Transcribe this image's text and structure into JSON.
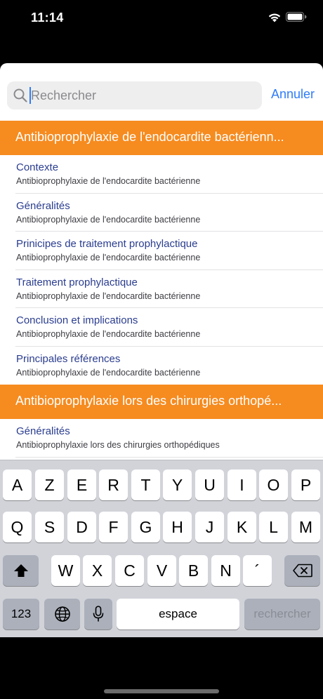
{
  "status_bar": {
    "time": "11:14"
  },
  "search": {
    "placeholder": "Rechercher",
    "value": "",
    "cancel_label": "Annuler"
  },
  "sections": [
    {
      "header": "Antibioprophylaxie de l'endocardite bactérienn...",
      "rows": [
        {
          "title": "Contexte",
          "subtitle": "Antibioprophylaxie de l'endocardite bactérienne"
        },
        {
          "title": "Généralités",
          "subtitle": "Antibioprophylaxie de l'endocardite bactérienne"
        },
        {
          "title": "Prinicipes de traitement prophylactique",
          "subtitle": "Antibioprophylaxie de l'endocardite bactérienne"
        },
        {
          "title": "Traitement prophylactique",
          "subtitle": "Antibioprophylaxie de l'endocardite bactérienne"
        },
        {
          "title": "Conclusion et implications",
          "subtitle": "Antibioprophylaxie de l'endocardite bactérienne"
        },
        {
          "title": "Principales références",
          "subtitle": "Antibioprophylaxie de l'endocardite bactérienne"
        }
      ]
    },
    {
      "header": "Antibioprophylaxie lors des chirurgies orthopé...",
      "rows": [
        {
          "title": "Généralités",
          "subtitle": "Antibioprophylaxie lors des chirurgies orthopédiques"
        }
      ]
    }
  ],
  "keyboard": {
    "row1": [
      "A",
      "Z",
      "E",
      "R",
      "T",
      "Y",
      "U",
      "I",
      "O",
      "P"
    ],
    "row2": [
      "Q",
      "S",
      "D",
      "F",
      "G",
      "H",
      "J",
      "K",
      "L",
      "M"
    ],
    "row3": [
      "W",
      "X",
      "C",
      "V",
      "B",
      "N",
      "´"
    ],
    "numbers_label": "123",
    "space_label": "espace",
    "search_label": "rechercher",
    "shift_icon": "shift-icon",
    "delete_icon": "delete-icon",
    "globe_icon": "globe-icon",
    "mic_icon": "microphone-icon"
  },
  "colors": {
    "accent_orange": "#f68b1f",
    "link_blue": "#2f7cf6",
    "row_title": "#2a3d8f"
  }
}
